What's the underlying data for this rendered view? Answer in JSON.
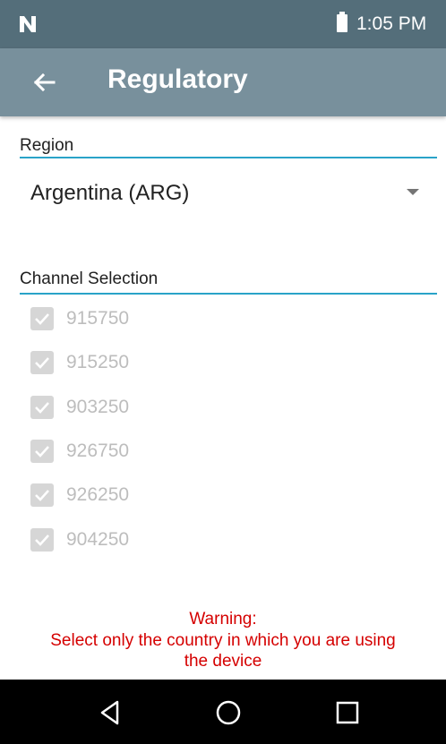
{
  "status_bar": {
    "time": "1:05 PM",
    "icons": [
      "n-logo-icon",
      "battery-icon"
    ]
  },
  "app_bar": {
    "title": "Regulatory",
    "back_icon": "arrow-left-icon"
  },
  "region": {
    "label": "Region",
    "selected": "Argentina (ARG)"
  },
  "channel_section": {
    "label": "Channel Selection",
    "channels": [
      {
        "value": "915750",
        "checked": true,
        "disabled": true
      },
      {
        "value": "915250",
        "checked": true,
        "disabled": true
      },
      {
        "value": "903250",
        "checked": true,
        "disabled": true
      },
      {
        "value": "926750",
        "checked": true,
        "disabled": true
      },
      {
        "value": "926250",
        "checked": true,
        "disabled": true
      },
      {
        "value": "904250",
        "checked": true,
        "disabled": true
      }
    ]
  },
  "warning": {
    "title": "Warning:",
    "line1": "Select only the country in which you are using",
    "line2": "the device"
  },
  "nav_bar": {
    "icons": [
      "back-triangle-icon",
      "home-circle-icon",
      "recents-square-icon"
    ]
  },
  "colors": {
    "status_bar": "#546e7a",
    "app_bar": "#78909c",
    "accent": "#29a3c8",
    "warning": "#d50000"
  }
}
